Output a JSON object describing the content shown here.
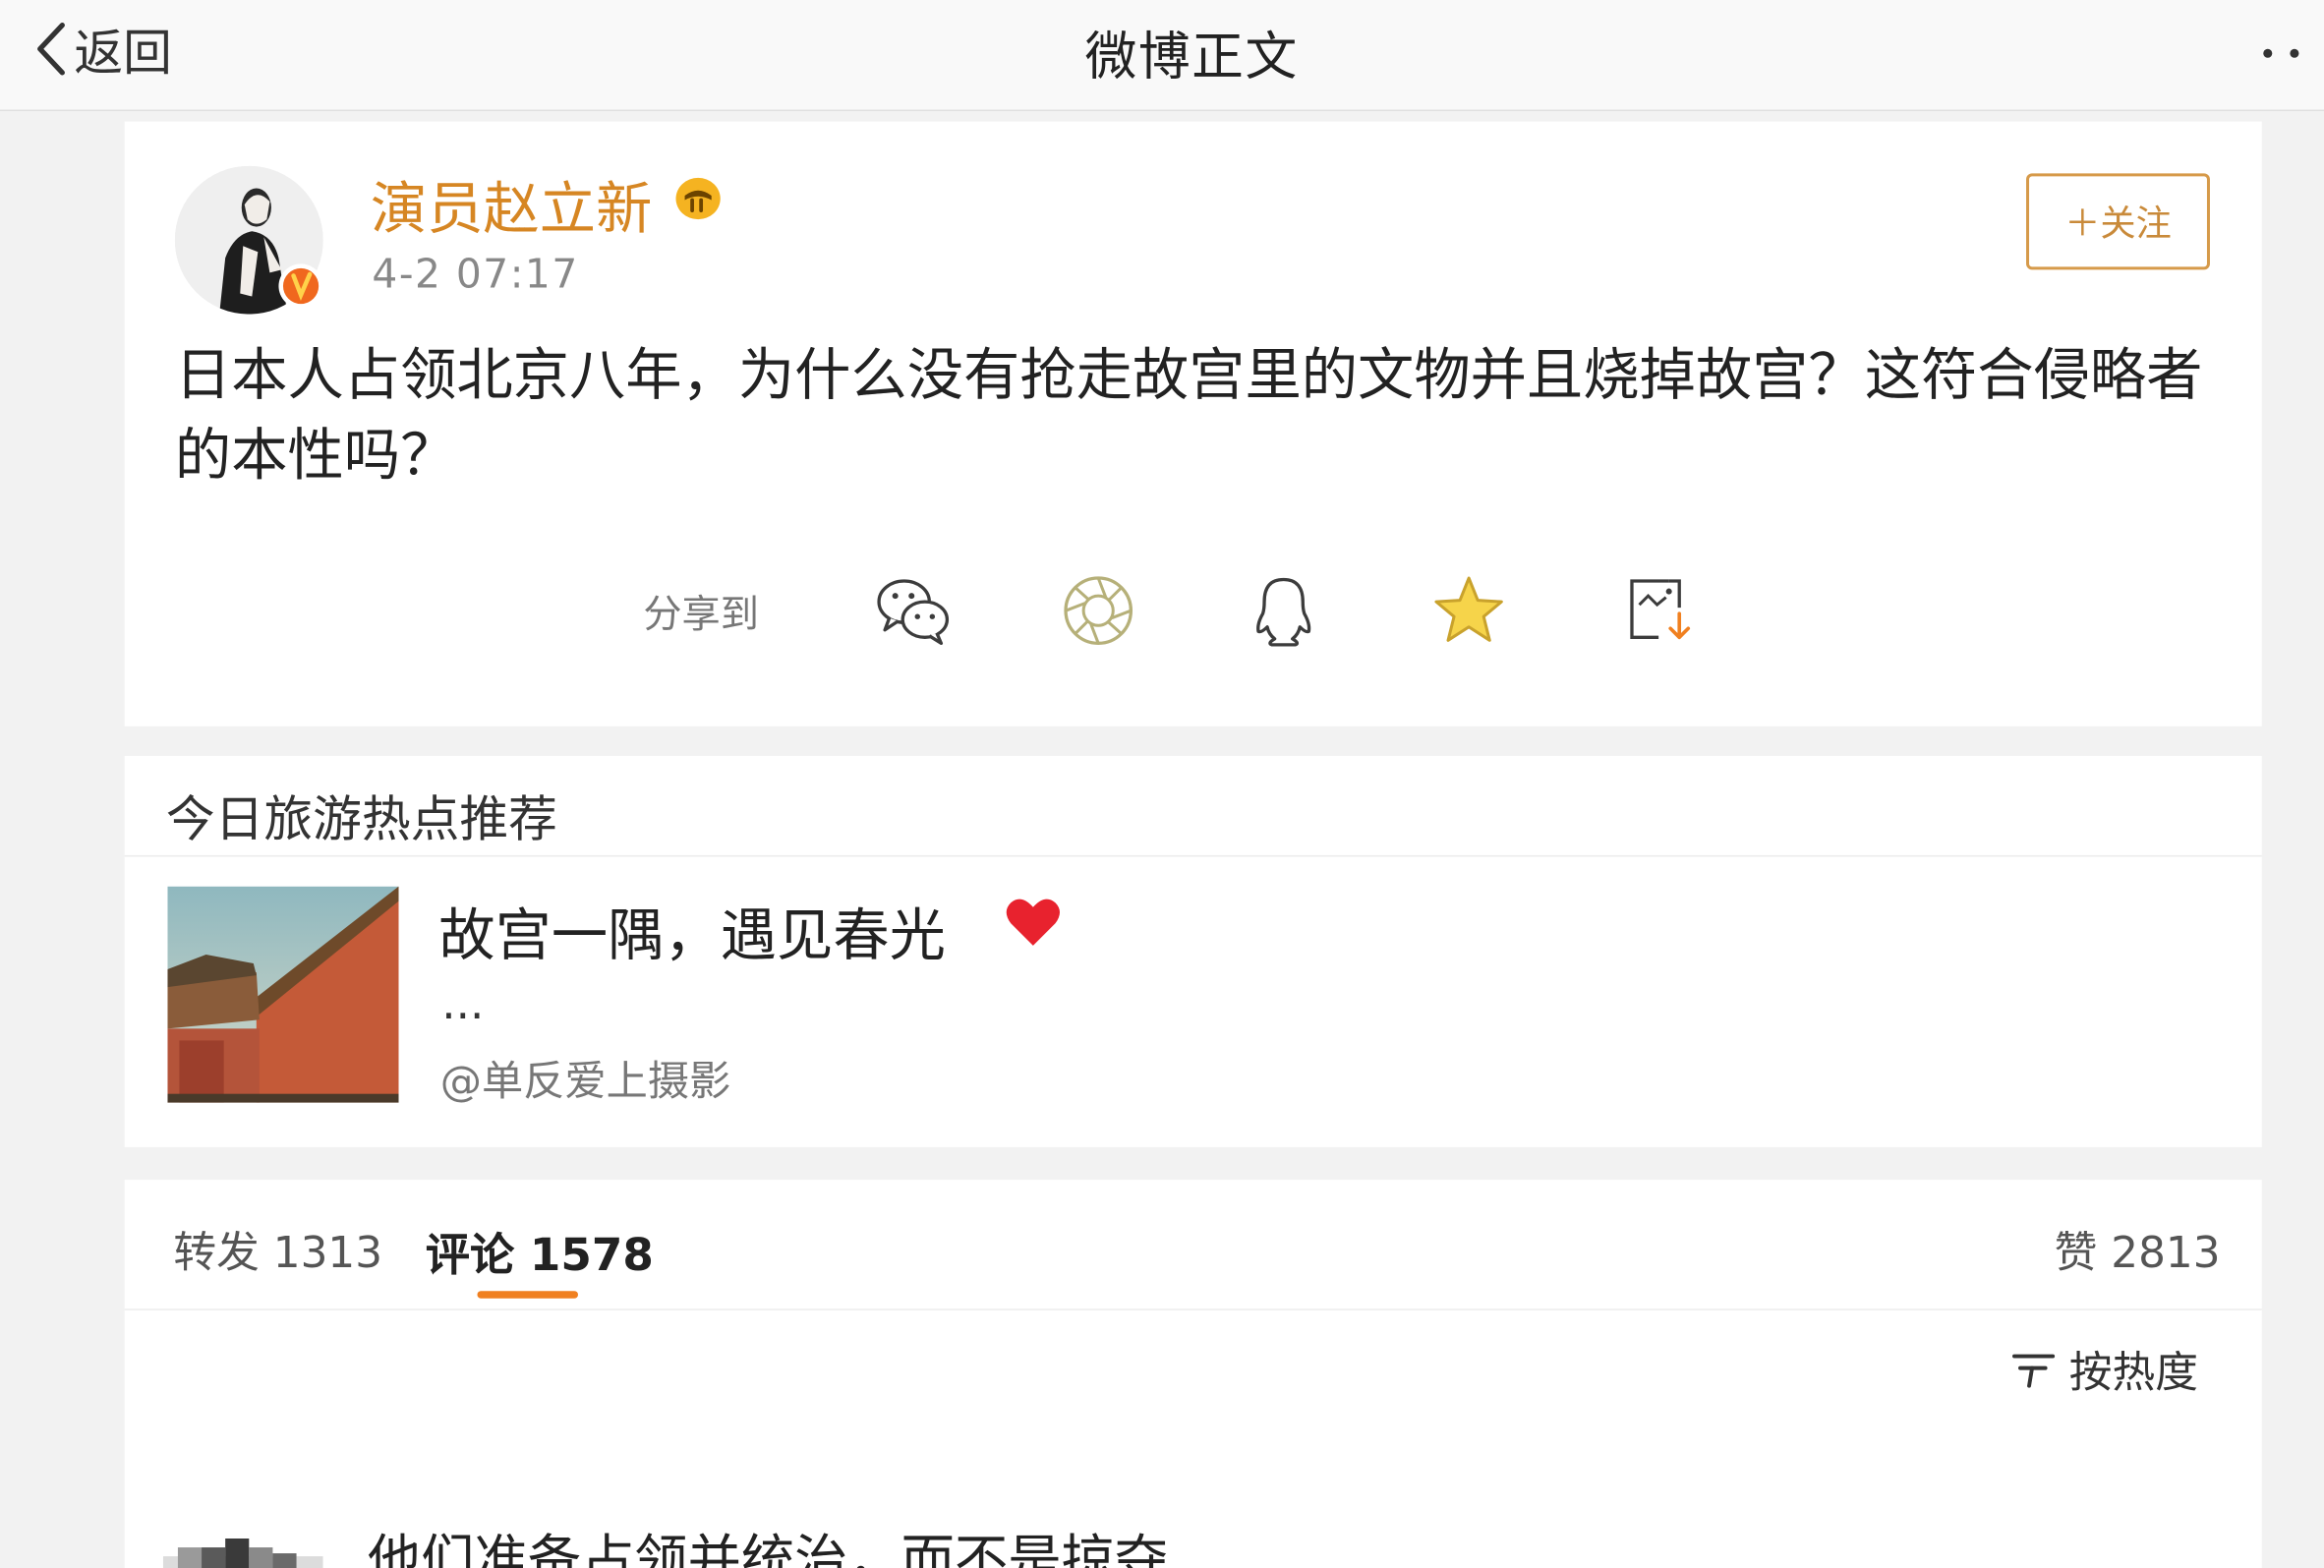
{
  "nav": {
    "back_label": "返回",
    "title": "微博正文",
    "back_icon": "chevron-left-icon",
    "more_icon": "more-dots-icon"
  },
  "post": {
    "author": "演员赵立新",
    "time": "4-2 07:17",
    "follow_label": "＋关注",
    "text": "日本人占领北京八年，为什么没有抢走故宫里的文物并且烧掉故宫？这符合侵略者的本性吗？",
    "icons": [
      "avatar",
      "verified-badge-icon",
      "vip-icon"
    ]
  },
  "share": {
    "label": "分享到",
    "icons": [
      "wechat-icon",
      "moments-icon",
      "qq-icon",
      "favorite-star-icon",
      "save-image-icon"
    ]
  },
  "recommendation": {
    "header": "今日旅游热点推荐",
    "title": "故宫一隅，遇见春光",
    "ellipsis": "...",
    "source": "@单反爱上摄影",
    "icons": [
      "heart-icon"
    ]
  },
  "tabs": {
    "repost": "转发 1313",
    "comment": "评论 1578",
    "like": "赞 2813"
  },
  "sort": {
    "label": "按热度",
    "icon": "sort-icon"
  },
  "comment_preview": {
    "text": "他们准备占领并统治，而不是掠夺"
  },
  "colors": {
    "author": "#d68623",
    "follow": "#c98a3a",
    "tab_indicator": "#f08020",
    "heart": "#e8222e",
    "page_bg": "#f2f2f2",
    "card_bg": "#ffffff"
  }
}
